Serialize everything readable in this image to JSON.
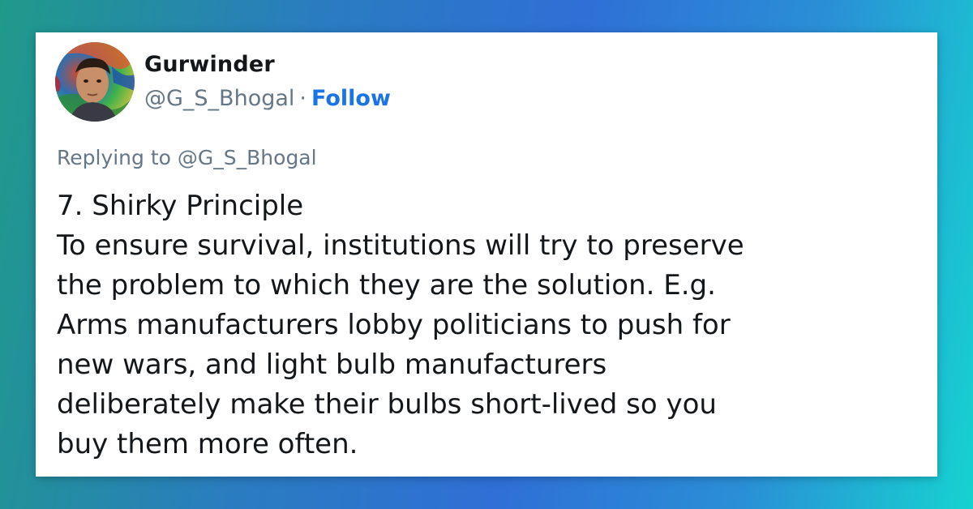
{
  "tweet": {
    "author_name": "Gurwinder",
    "author_handle": "@G_S_Bhogal",
    "separator": "·",
    "follow_label": "Follow",
    "replying_prefix": "Replying to",
    "replying_handle": "@G_S_Bhogal",
    "lines": [
      "7. Shirky Principle",
      "To ensure survival, institutions will try to preserve",
      "the problem to which they are the solution. E.g.",
      "Arms manufacturers lobby politicians to push for",
      "new wars, and light bulb manufacturers",
      "deliberately make their bulbs short-lived so you",
      "buy them more often."
    ]
  },
  "colors": {
    "follow": "#1b74e4",
    "muted": "#657786",
    "text": "#14171a"
  }
}
